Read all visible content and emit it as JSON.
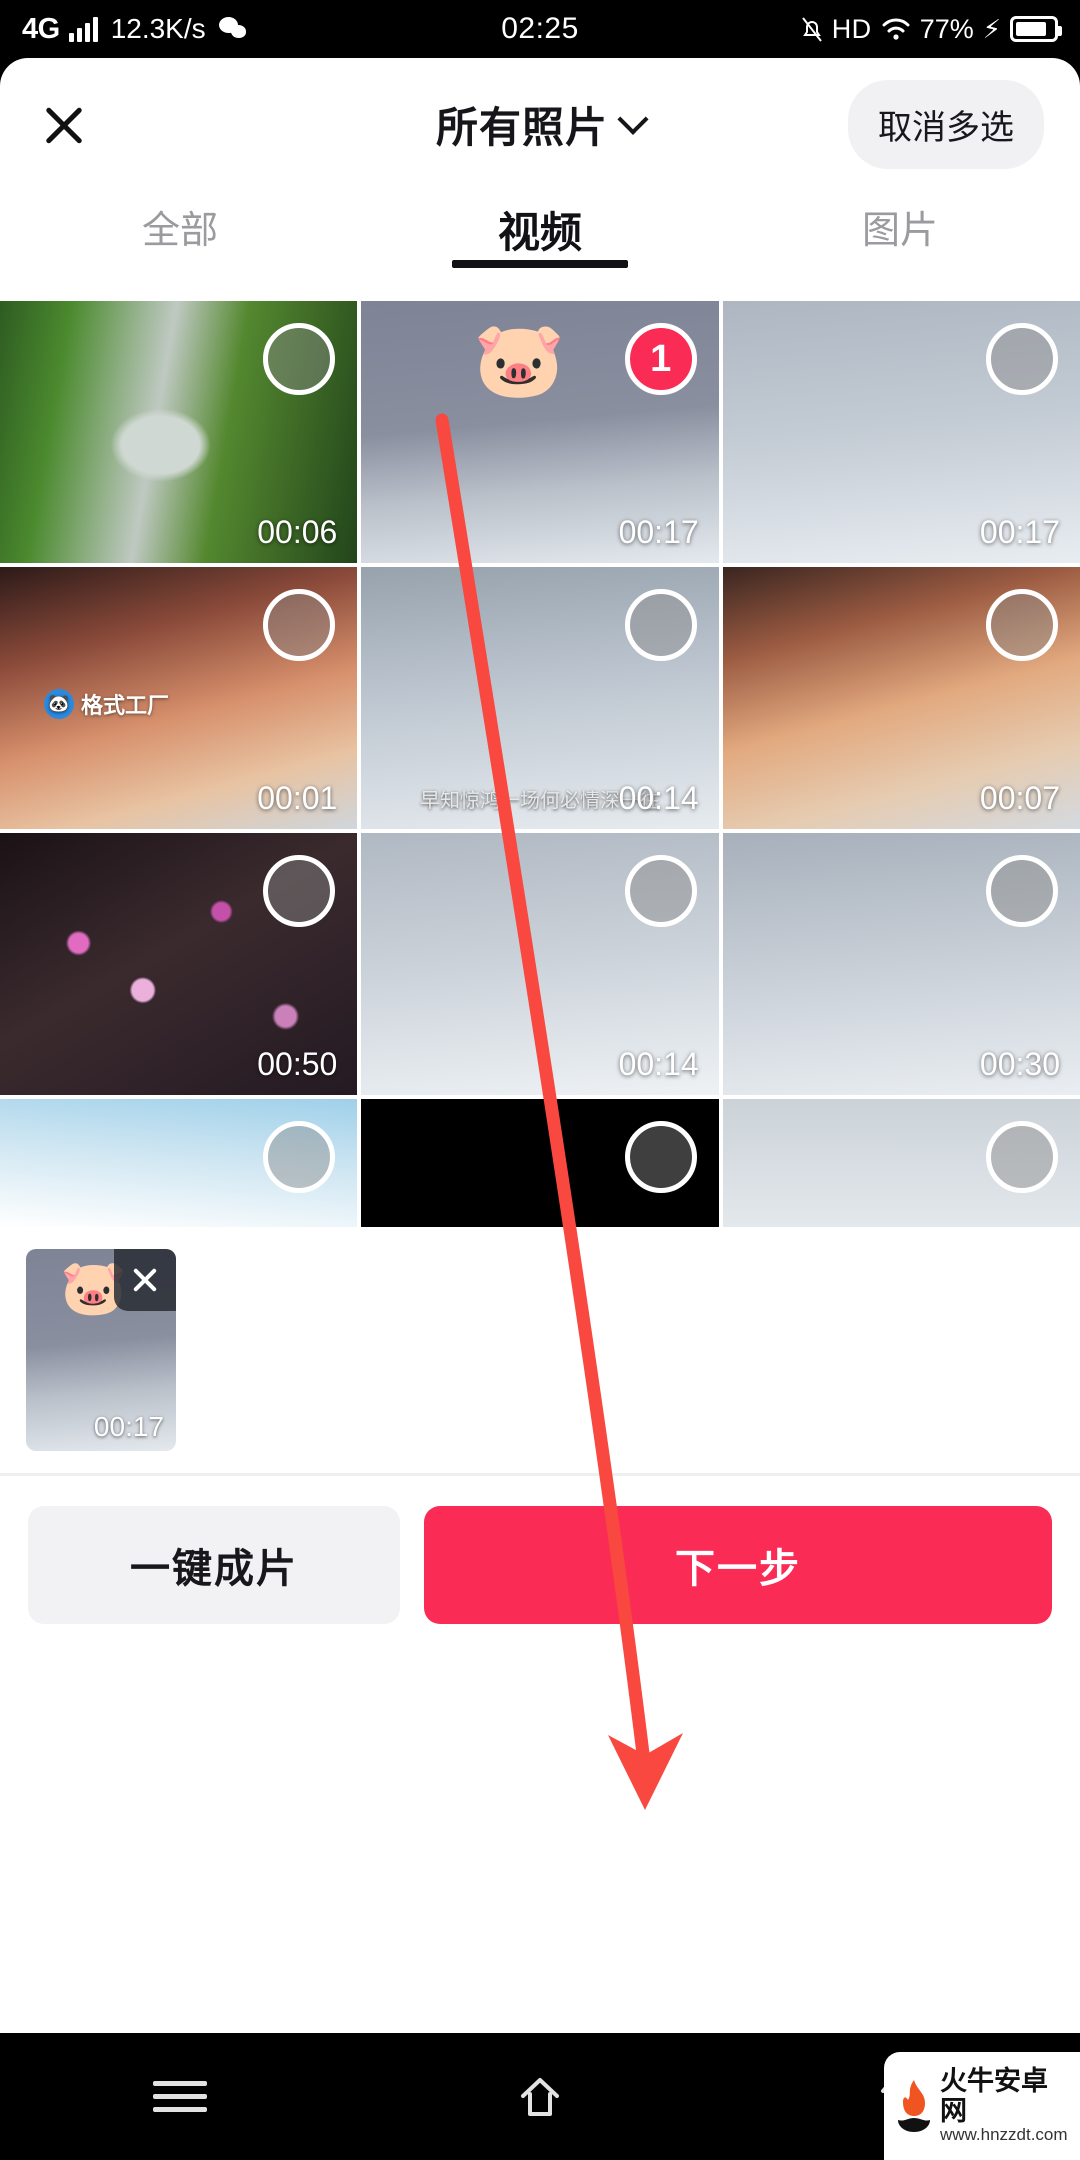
{
  "statusbar": {
    "network": "4G",
    "speed": "12.3K/s",
    "wechat_icon": "wechat-icon",
    "time": "02:25",
    "mute_icon": "bell-muted-icon",
    "hd": "HD",
    "wifi_icon": "wifi-icon",
    "battery_pct": "77%",
    "charging_icon": "bolt-icon"
  },
  "header": {
    "close_icon": "close-icon",
    "title": "所有照片",
    "chevron_icon": "chevron-down-icon",
    "multiselect_label": "取消多选"
  },
  "tabs": [
    {
      "label": "全部",
      "active": false
    },
    {
      "label": "视频",
      "active": true
    },
    {
      "label": "图片",
      "active": false
    }
  ],
  "grid": {
    "items": [
      {
        "id": "c1",
        "art": "a-waterfall",
        "duration": "00:06",
        "selected": false,
        "badge": "",
        "pig": false,
        "watermark": "",
        "caption": ""
      },
      {
        "id": "c2",
        "art": "a-snow1",
        "duration": "00:17",
        "selected": true,
        "badge": "1",
        "pig": true,
        "watermark": "",
        "caption": ""
      },
      {
        "id": "c3",
        "art": "a-snow2",
        "duration": "00:17",
        "selected": false,
        "badge": "",
        "pig": false,
        "watermark": "",
        "caption": ""
      },
      {
        "id": "c4",
        "art": "a-sunset",
        "duration": "00:01",
        "selected": false,
        "badge": "",
        "pig": false,
        "watermark": "格式工厂",
        "caption": ""
      },
      {
        "id": "c5",
        "art": "a-snowtree",
        "duration": "00:14",
        "selected": false,
        "badge": "",
        "pig": false,
        "watermark": "",
        "caption": "早知惊鸿一场何必情深一往"
      },
      {
        "id": "c6",
        "art": "a-sunset2",
        "duration": "00:07",
        "selected": false,
        "badge": "",
        "pig": false,
        "watermark": "",
        "caption": ""
      },
      {
        "id": "c7",
        "art": "a-blossom",
        "duration": "00:50",
        "selected": false,
        "badge": "",
        "pig": false,
        "watermark": "",
        "caption": ""
      },
      {
        "id": "c8",
        "art": "a-snow3",
        "duration": "00:14",
        "selected": false,
        "badge": "",
        "pig": false,
        "watermark": "",
        "caption": ""
      },
      {
        "id": "c9",
        "art": "a-snow4",
        "duration": "00:30",
        "selected": false,
        "badge": "",
        "pig": false,
        "watermark": "",
        "caption": ""
      },
      {
        "id": "c10",
        "art": "a-birds",
        "duration": "",
        "selected": false,
        "badge": "",
        "pig": false,
        "watermark": "",
        "caption": ""
      },
      {
        "id": "c11",
        "art": "a-black",
        "duration": "",
        "selected": false,
        "badge": "",
        "pig": false,
        "watermark": "",
        "caption": ""
      },
      {
        "id": "c12",
        "art": "a-grayfog",
        "duration": "",
        "selected": false,
        "badge": "",
        "pig": false,
        "watermark": "",
        "caption": ""
      }
    ]
  },
  "selected_strip": {
    "items": [
      {
        "art": "a-snow1",
        "duration": "00:17",
        "remove_icon": "close-icon",
        "pig": true
      }
    ]
  },
  "actions": {
    "secondary_label": "一键成片",
    "primary_label": "下一步",
    "primary_color": "#FA2C55",
    "secondary_color": "#F2F2F4"
  },
  "navbar": {
    "menu_icon": "menu-icon",
    "home_icon": "home-icon",
    "back_icon": "back-icon"
  },
  "site_watermark": {
    "name": "火牛安卓网",
    "url": "www.hnzzdt.com",
    "logo_icon": "flame-icon"
  },
  "annotation": {
    "arrow_icon": "arrow-down-icon",
    "arrow_color": "#F8483F"
  }
}
